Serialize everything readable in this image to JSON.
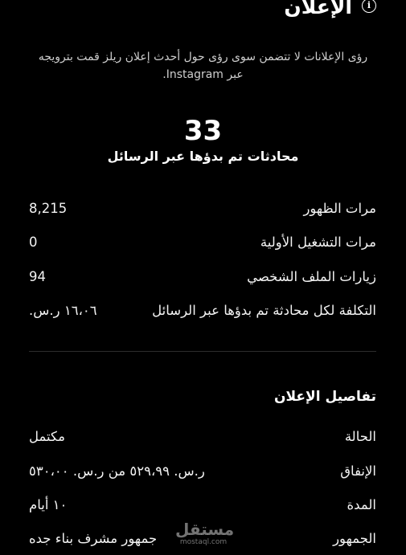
{
  "header": {
    "title": "الإعلان",
    "info_icon": "info-icon"
  },
  "disclaimer": "رؤى الإعلانات لا تتضمن سوى رؤى حول أحدث إعلان ريلز قمت بترويجه عبر Instagram.",
  "highlight": {
    "value": "33",
    "label": "محادثات تم بدؤها عبر الرسائل"
  },
  "metrics": [
    {
      "label": "مرات الظهور",
      "value": "8,215"
    },
    {
      "label": "مرات التشغيل الأولية",
      "value": "0"
    },
    {
      "label": "زيارات الملف الشخصي",
      "value": "94"
    },
    {
      "label": "التكلفة لكل محادثة تم بدؤها عبر الرسائل",
      "value": "١٦،٠٦ ر.س."
    }
  ],
  "details": {
    "title": "تفاصيل الإعلان",
    "rows": [
      {
        "label": "الحالة",
        "value": "مكتمل"
      },
      {
        "label": "الإنفاق",
        "value": "ر.س. ٥٢٩،٩٩ من ر.س. ٥٣٠،٠٠"
      },
      {
        "label": "المدة",
        "value": "١٠ أيام"
      },
      {
        "label": "الجمهور",
        "value": "جمهور مشرف بناء جده"
      }
    ]
  },
  "watermark": {
    "main": "مستقل",
    "sub": "mostaql.com"
  }
}
